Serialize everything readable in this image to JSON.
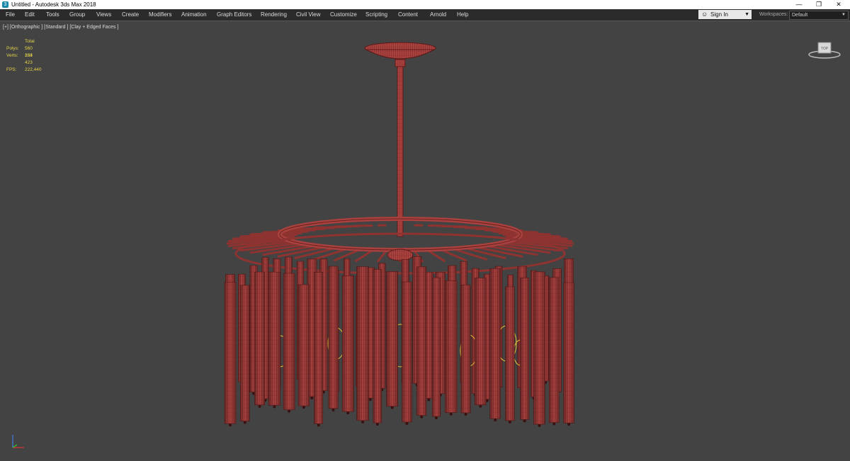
{
  "window": {
    "title": "Untitled - Autodesk 3ds Max 2018",
    "icon": "3ds-max-app-icon",
    "controls": {
      "minimize": "—",
      "restore": "❐",
      "close": "✕"
    }
  },
  "menu": {
    "items": [
      "File",
      "Edit",
      "Tools",
      "Group",
      "Views",
      "Create",
      "Modifiers",
      "Animation",
      "Graph Editors",
      "Rendering",
      "Civil View",
      "Customize",
      "Scripting",
      "Content",
      "Arnold",
      "Help"
    ],
    "sign_in": "Sign In",
    "workspaces_label": "Workspaces:",
    "workspace_value": "Default"
  },
  "viewport": {
    "label": "[+] [Orthographic ] [Standard ] [Clay + Edged Faces ]",
    "stats": {
      "header": "Total",
      "polys_label": "Polys:",
      "polys_value": "560 184",
      "verts_label": "Verts:",
      "verts_value": "283 423",
      "fps_label": "FPS:",
      "fps_value": "222,440"
    },
    "viewcube_label": "TOP"
  },
  "colors": {
    "model": "#a9413f",
    "model_edge": "#5a1a18",
    "viewport_bg": "#434343",
    "stats_text": "#e6d34a"
  }
}
